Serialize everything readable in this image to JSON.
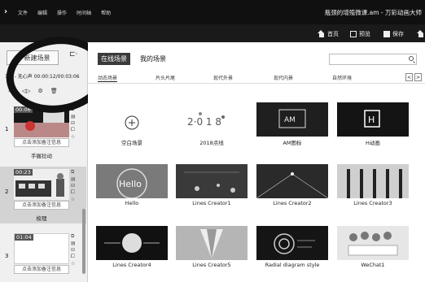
{
  "titlebar": {
    "menu": [
      "文件",
      "编辑",
      "操作",
      "时间轴",
      "帮助"
    ],
    "doc_title": "瓶颈的增殖微课.am - 万彩动画大师"
  },
  "toolbar": {
    "home": "首页",
    "preview": "预览",
    "save": "保存"
  },
  "left": {
    "new_scene": "新建场景",
    "mic_info": "1级 - 无心声 00:00:12/00:03:06",
    "scenes": [
      {
        "num": "1",
        "duration": "00:06",
        "note": "点击添加备注信息",
        "name": "手握拉动"
      },
      {
        "num": "2",
        "duration": "00:23",
        "note": "点击添加备注信息",
        "name": "梳理"
      },
      {
        "num": "3",
        "duration": "01:04",
        "note": "点击添加备注信息",
        "name": ""
      }
    ]
  },
  "right": {
    "tabs": [
      "在线场景",
      "我的场景"
    ],
    "search": {
      "placeholder": ""
    },
    "categories": [
      "动态场景",
      "片头片尾",
      "现代外景",
      "现代内景",
      "自然环境"
    ],
    "tiles": [
      {
        "label": "空白场景",
        "bg": "#ffffff"
      },
      {
        "label": "2018点线",
        "bg": "#ffffff"
      },
      {
        "label": "AM图标",
        "bg": "#1f1f1f"
      },
      {
        "label": "H动画",
        "bg": "#141414"
      },
      {
        "label": "Hello",
        "bg": "#7a7a7a"
      },
      {
        "label": "Lines Creator1",
        "bg": "#3a3a3a"
      },
      {
        "label": "Lines Creator2",
        "bg": "#2a2a2a"
      },
      {
        "label": "Lines Creator3",
        "bg": "#cfcfcf"
      },
      {
        "label": "Lines Creator4",
        "bg": "#111111"
      },
      {
        "label": "Lines Creator5",
        "bg": "#b5b5b5"
      },
      {
        "label": "Radial diagram style",
        "bg": "#151515"
      },
      {
        "label": "WeChat1",
        "bg": "#e6e6e6"
      }
    ]
  }
}
